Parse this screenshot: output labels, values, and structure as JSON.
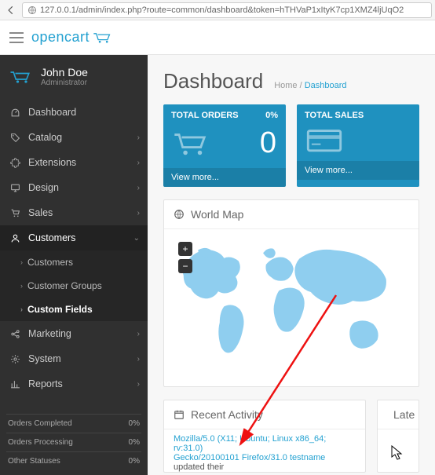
{
  "browser": {
    "url": "127.0.0.1/admin/index.php?route=common/dashboard&token=hTHVaP1xItyK7cp1XMZ4ljUqO2"
  },
  "brand": {
    "name": "opencart"
  },
  "user": {
    "name": "John Doe",
    "role": "Administrator"
  },
  "sidebar": {
    "items": [
      {
        "label": "Dashboard",
        "icon": "dashboard-icon"
      },
      {
        "label": "Catalog",
        "icon": "tag-icon"
      },
      {
        "label": "Extensions",
        "icon": "puzzle-icon"
      },
      {
        "label": "Design",
        "icon": "desktop-icon"
      },
      {
        "label": "Sales",
        "icon": "cart-icon"
      },
      {
        "label": "Customers",
        "icon": "user-icon"
      },
      {
        "label": "Marketing",
        "icon": "share-icon"
      },
      {
        "label": "System",
        "icon": "gear-icon"
      },
      {
        "label": "Reports",
        "icon": "chart-icon"
      }
    ],
    "sub_customers": {
      "items": [
        {
          "label": "Customers"
        },
        {
          "label": "Customer Groups"
        },
        {
          "label": "Custom Fields"
        }
      ]
    },
    "statuses": [
      {
        "label": "Orders Completed",
        "value": "0%"
      },
      {
        "label": "Orders Processing",
        "value": "0%"
      },
      {
        "label": "Other Statuses",
        "value": "0%"
      }
    ]
  },
  "page": {
    "title": "Dashboard",
    "crumb_home": "Home",
    "crumb_sep": "/",
    "crumb_current": "Dashboard"
  },
  "tiles": {
    "orders": {
      "title": "TOTAL ORDERS",
      "pct": "0%",
      "value": "0",
      "more": "View more..."
    },
    "sales": {
      "title": "TOTAL SALES",
      "pct": "",
      "value": "",
      "more": "View more..."
    }
  },
  "panels": {
    "map": {
      "title": "World Map"
    },
    "activity": {
      "title": "Recent Activity",
      "line_link": "Mozilla/5.0 (X11; Ubuntu; Linux x86_64; rv:31.0)",
      "line_rest_a": "Gecko/20100101 Firefox/31.0 testname",
      "line_rest_b": " updated their"
    },
    "latest": {
      "title": "Late"
    }
  }
}
